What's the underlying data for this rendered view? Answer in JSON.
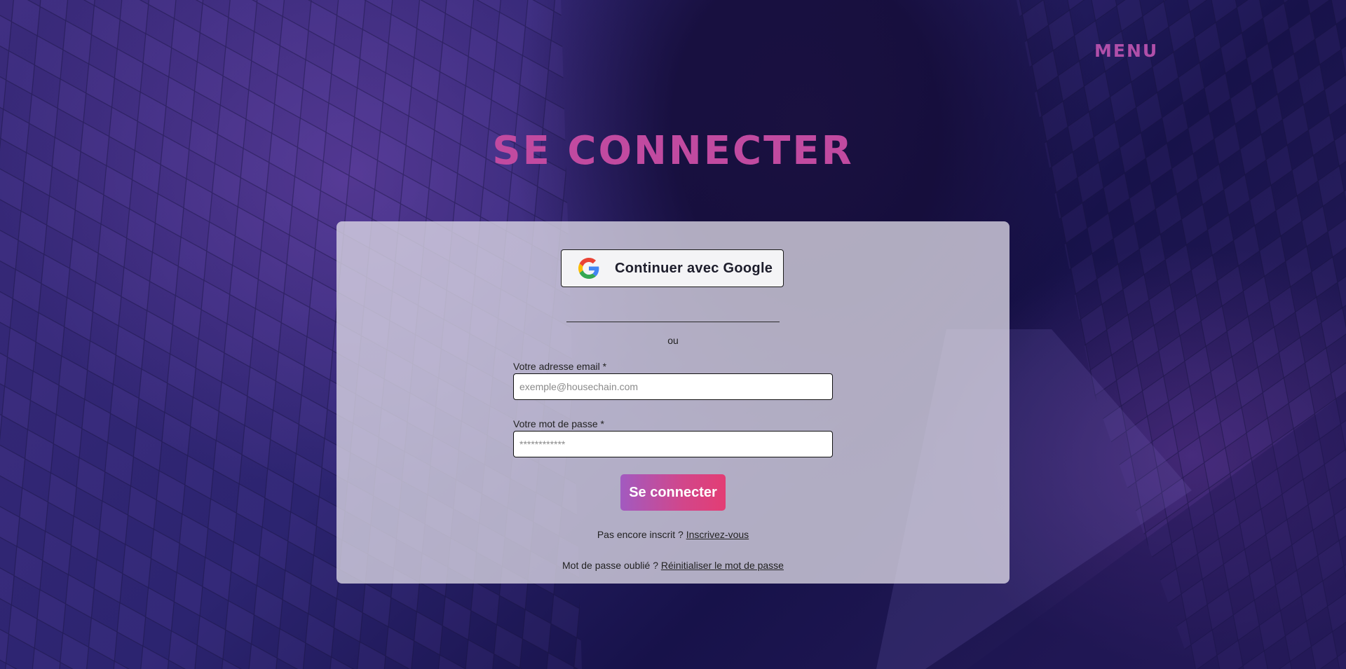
{
  "header": {
    "menu_label": "MENU"
  },
  "page": {
    "title": "SE CONNECTER"
  },
  "login": {
    "google_button_label": "Continuer avec Google",
    "separator_text": "ou",
    "email_label": "Votre adresse email *",
    "email_placeholder": "exemple@housechain.com",
    "email_value": "",
    "password_label": "Votre mot de passe *",
    "password_placeholder": "************",
    "password_value": "",
    "submit_label": "Se connecter",
    "signup_prompt": "Pas encore inscrit ?",
    "signup_link": "Inscrivez-vous",
    "forgot_prompt": "Mot de passe oublié ?",
    "forgot_link": "Réinitialiser le mot de passe"
  },
  "icons": {
    "google": "google-g-logo",
    "menu": "menu-text"
  },
  "colors": {
    "accent": "#c14aa0",
    "menu": "#b04fa9",
    "button_gradient_start": "#a25ac0",
    "button_gradient_end": "#e33d74",
    "card_background": "#dcd8e6"
  }
}
